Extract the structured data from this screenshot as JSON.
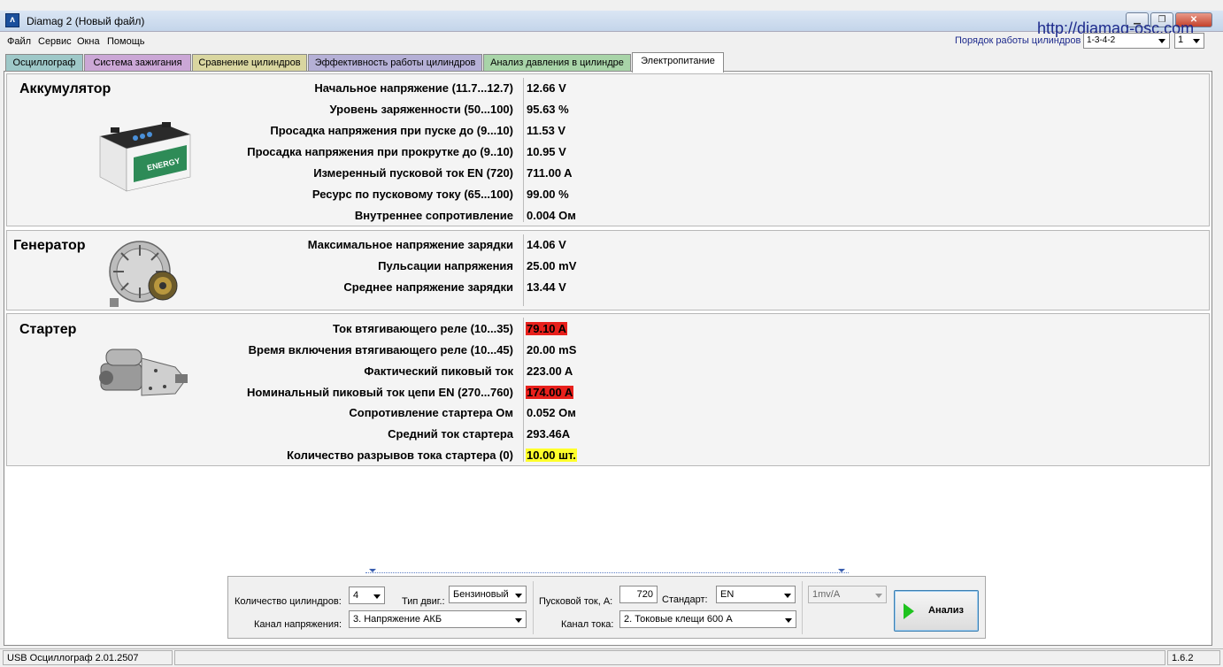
{
  "window": {
    "title": "Diamag 2 (Новый файл)",
    "url": "http://diamag-osc.com"
  },
  "menu": [
    "Файл",
    "Сервис",
    "Окна",
    "Помощь"
  ],
  "cylinder_order": {
    "label": "Порядок работы цилиндров",
    "value": "1-3-4-2",
    "cylinder": "1"
  },
  "tabs": [
    {
      "label": "Осциллограф",
      "color": "#9ec8c8"
    },
    {
      "label": "Система зажигания",
      "color": "#cba7d6"
    },
    {
      "label": "Сравнение цилиндров",
      "color": "#d9d6a0"
    },
    {
      "label": "Эффективность работы цилиндров",
      "color": "#b5b0d6"
    },
    {
      "label": "Анализ давления в цилиндре",
      "color": "#a8d4a8"
    },
    {
      "label": "Электропитание",
      "color": "#ffffff"
    }
  ],
  "battery": {
    "title": "Аккумулятор",
    "rows": [
      {
        "label": "Начальное напряжение (11.7...12.7)",
        "value": "12.66 V",
        "status": "normal"
      },
      {
        "label": "Уровень заряженности (50...100)",
        "value": "95.63 %",
        "status": "normal"
      },
      {
        "label": "Просадка напряжения при пуске до (9...10)",
        "value": "11.53 V",
        "status": "normal"
      },
      {
        "label": "Просадка напряжения при прокрутке до  (9..10)",
        "value": "10.95 V",
        "status": "normal"
      },
      {
        "label": "Измеренный пусковой ток  EN (720)",
        "value": "711.00 A",
        "status": "normal"
      },
      {
        "label": "Ресурс по пусковому току (65...100)",
        "value": "99.00 %",
        "status": "normal"
      },
      {
        "label": "Внутреннее сопротивление",
        "value": "0.004 Ом",
        "status": "normal"
      }
    ],
    "image_text": "ENERGY"
  },
  "generator": {
    "title": "Генератор",
    "rows": [
      {
        "label": "Максимальное напряжение зарядки",
        "value": "14.06 V",
        "status": "normal"
      },
      {
        "label": "Пульсации напряжения",
        "value": "25.00 mV",
        "status": "normal"
      },
      {
        "label": "Среднее напряжение зарядки",
        "value": "13.44 V",
        "status": "normal"
      }
    ]
  },
  "starter": {
    "title": "Стартер",
    "rows": [
      {
        "label": "Ток втягивающего реле (10...35)",
        "value": "79.10 A",
        "status": "red"
      },
      {
        "label": "Время включения втягивающего реле (10...45)",
        "value": "20.00 mS",
        "status": "normal"
      },
      {
        "label": "Фактический пиковый ток",
        "value": "223.00 A",
        "status": "normal"
      },
      {
        "label": "Номинальный пиковый ток цепи EN (270...760)",
        "value": "174.00 A",
        "status": "red"
      },
      {
        "label": "Сопротивление стартера Ом",
        "value": "0.052 Ом",
        "status": "normal"
      },
      {
        "label": "Средний ток стартера",
        "value": "293.46A",
        "status": "normal"
      },
      {
        "label": "Количество разрывов тока стартера (0)",
        "value": "10.00 шт.",
        "status": "yellow"
      }
    ]
  },
  "controls": {
    "cylinders_label": "Количество цилиндров:",
    "cylinders_value": "4",
    "engine_type_label": "Тип двиг.:",
    "engine_type_value": "Бензиновый",
    "voltage_channel_label": "Канал напряжения:",
    "voltage_channel_value": "3.  Напряжение АКБ",
    "cranking_current_label": "Пусковой ток, А:",
    "cranking_current_value": "720",
    "standard_label": "Стандарт:",
    "standard_value": "EN",
    "current_channel_label": "Канал тока:",
    "current_channel_value": "2.  Токовые клещи 600 А",
    "scale_value": "1mv/A",
    "analyze_label": "Анализ"
  },
  "status": {
    "device": "USB Осциллограф  2.01.2507",
    "version": "1.6.2"
  }
}
